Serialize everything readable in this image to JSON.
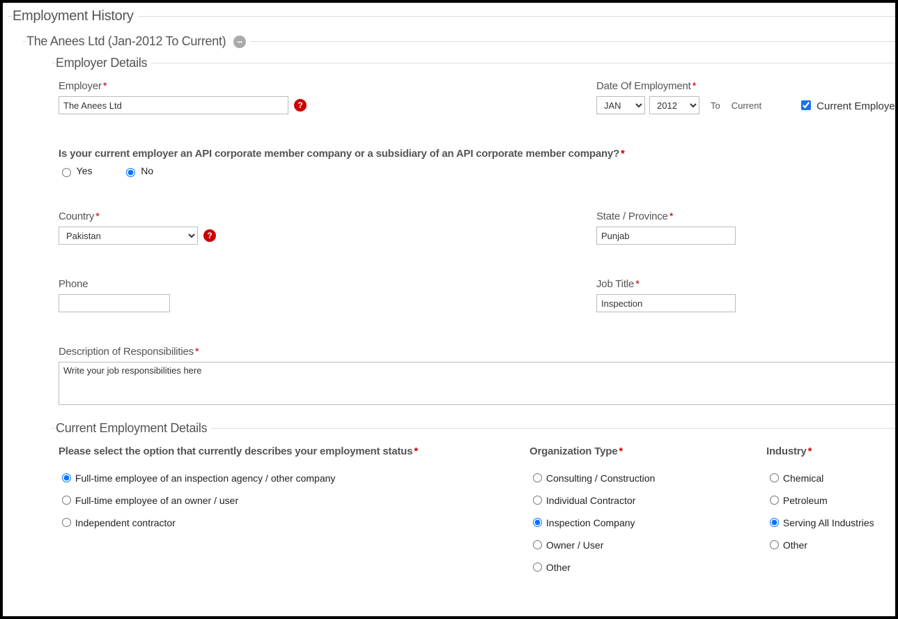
{
  "sections": {
    "employment_history": "Employment History",
    "entry_title": "The Anees Ltd  (Jan-2012 To Current)",
    "employer_details": "Employer Details",
    "current_employment_details": "Current Employment Details"
  },
  "employer": {
    "label": "Employer",
    "value": "The Anees Ltd"
  },
  "date_of_employment": {
    "label": "Date Of Employment",
    "month": "JAN",
    "year": "2012",
    "to_label": "To",
    "to_value": "Current",
    "current_employer_label": "Current Employer",
    "current_employer_checked": true
  },
  "api_member": {
    "question": "Is your current employer an API corporate member company or a subsidiary of an API corporate member company?",
    "yes": "Yes",
    "no": "No",
    "selected": "no"
  },
  "country": {
    "label": "Country",
    "value": "Pakistan"
  },
  "state": {
    "label": "State / Province",
    "value": "Punjab"
  },
  "phone": {
    "label": "Phone",
    "value": ""
  },
  "job_title": {
    "label": "Job Title",
    "value": "Inspection"
  },
  "responsibilities": {
    "label": "Description of Responsibilities",
    "value": "Write your job responsibilities here"
  },
  "employment_status": {
    "label": "Please select the option that currently describes your employment status",
    "options": {
      "fulltime_inspection": "Full-time employee of an inspection agency / other company",
      "fulltime_owner": "Full-time employee of an owner / user",
      "independent": "Independent contractor"
    },
    "selected": "fulltime_inspection"
  },
  "org_type": {
    "label": "Organization Type",
    "options": {
      "consulting": "Consulting / Construction",
      "individual": "Individual Contractor",
      "inspection": "Inspection Company",
      "owner": "Owner / User",
      "other": "Other"
    },
    "selected": "inspection"
  },
  "industry": {
    "label": "Industry",
    "options": {
      "chemical": "Chemical",
      "petroleum": "Petroleum",
      "serving_all": "Serving All Industries",
      "other": "Other"
    },
    "selected": "serving_all"
  }
}
